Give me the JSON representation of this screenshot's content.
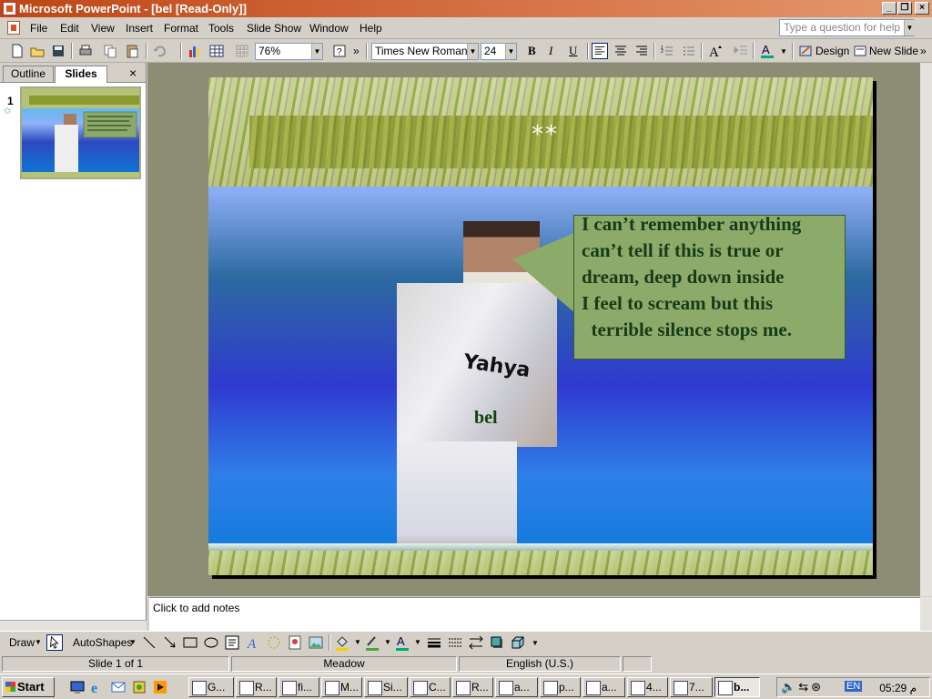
{
  "window": {
    "title": "Microsoft PowerPoint - [bel [Read-Only]]",
    "controls": {
      "minimize": "_",
      "restore": "❐",
      "close": "×"
    }
  },
  "menu": {
    "items": [
      "File",
      "Edit",
      "View",
      "Insert",
      "Format",
      "Tools",
      "Slide Show",
      "Window",
      "Help"
    ],
    "help_placeholder": "Type a question for help"
  },
  "toolbar": {
    "zoom": "76%",
    "font_name": "Times New Roman",
    "font_size": "24",
    "bold": "B",
    "italic": "I",
    "underline": "U",
    "design_label": "Design",
    "new_slide_label": "New Slide"
  },
  "left_pane": {
    "tabs": [
      "Outline",
      "Slides"
    ],
    "active_tab": "Slides",
    "close": "×",
    "slide_number": "1"
  },
  "slide": {
    "header_text": "**",
    "callout_text": "I can’t remember anything\ncan’t tell if this is true or\ndream, deep down inside\nI feel to scream but this\n  terrible silence stops me.",
    "name_label": "Yahya",
    "caption": "bel"
  },
  "notes": {
    "placeholder": "Click to add notes"
  },
  "draw_toolbar": {
    "draw_label": "Draw",
    "autoshapes_label": "AutoShapes"
  },
  "status": {
    "slide_info": "Slide 1 of 1",
    "design": "Meadow",
    "language": "English (U.S.)"
  },
  "taskbar": {
    "start_label": "Start",
    "tasks": [
      "G...",
      "R...",
      "fi...",
      "M...",
      "Si...",
      "C...",
      "R...",
      "a...",
      "p...",
      "a...",
      "4...",
      "7...",
      "b..."
    ],
    "active_task": "b...",
    "language": "EN",
    "clock": "05:29 م"
  },
  "colors": {
    "title_bar": "#bd4716",
    "slide_bg": "#2f6ad0",
    "callout_fill": "#8cab6a",
    "callout_text": "#173a17"
  }
}
